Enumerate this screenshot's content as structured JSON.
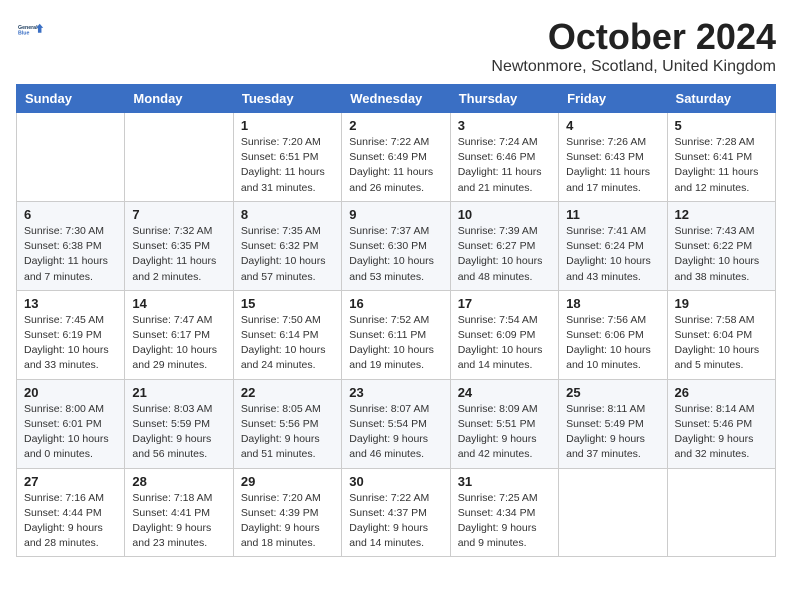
{
  "header": {
    "logo_line1": "General",
    "logo_line2": "Blue",
    "month_title": "October 2024",
    "location": "Newtonmore, Scotland, United Kingdom"
  },
  "days_of_week": [
    "Sunday",
    "Monday",
    "Tuesday",
    "Wednesday",
    "Thursday",
    "Friday",
    "Saturday"
  ],
  "weeks": [
    [
      {
        "num": "",
        "detail": ""
      },
      {
        "num": "",
        "detail": ""
      },
      {
        "num": "1",
        "detail": "Sunrise: 7:20 AM\nSunset: 6:51 PM\nDaylight: 11 hours and 31 minutes."
      },
      {
        "num": "2",
        "detail": "Sunrise: 7:22 AM\nSunset: 6:49 PM\nDaylight: 11 hours and 26 minutes."
      },
      {
        "num": "3",
        "detail": "Sunrise: 7:24 AM\nSunset: 6:46 PM\nDaylight: 11 hours and 21 minutes."
      },
      {
        "num": "4",
        "detail": "Sunrise: 7:26 AM\nSunset: 6:43 PM\nDaylight: 11 hours and 17 minutes."
      },
      {
        "num": "5",
        "detail": "Sunrise: 7:28 AM\nSunset: 6:41 PM\nDaylight: 11 hours and 12 minutes."
      }
    ],
    [
      {
        "num": "6",
        "detail": "Sunrise: 7:30 AM\nSunset: 6:38 PM\nDaylight: 11 hours and 7 minutes."
      },
      {
        "num": "7",
        "detail": "Sunrise: 7:32 AM\nSunset: 6:35 PM\nDaylight: 11 hours and 2 minutes."
      },
      {
        "num": "8",
        "detail": "Sunrise: 7:35 AM\nSunset: 6:32 PM\nDaylight: 10 hours and 57 minutes."
      },
      {
        "num": "9",
        "detail": "Sunrise: 7:37 AM\nSunset: 6:30 PM\nDaylight: 10 hours and 53 minutes."
      },
      {
        "num": "10",
        "detail": "Sunrise: 7:39 AM\nSunset: 6:27 PM\nDaylight: 10 hours and 48 minutes."
      },
      {
        "num": "11",
        "detail": "Sunrise: 7:41 AM\nSunset: 6:24 PM\nDaylight: 10 hours and 43 minutes."
      },
      {
        "num": "12",
        "detail": "Sunrise: 7:43 AM\nSunset: 6:22 PM\nDaylight: 10 hours and 38 minutes."
      }
    ],
    [
      {
        "num": "13",
        "detail": "Sunrise: 7:45 AM\nSunset: 6:19 PM\nDaylight: 10 hours and 33 minutes."
      },
      {
        "num": "14",
        "detail": "Sunrise: 7:47 AM\nSunset: 6:17 PM\nDaylight: 10 hours and 29 minutes."
      },
      {
        "num": "15",
        "detail": "Sunrise: 7:50 AM\nSunset: 6:14 PM\nDaylight: 10 hours and 24 minutes."
      },
      {
        "num": "16",
        "detail": "Sunrise: 7:52 AM\nSunset: 6:11 PM\nDaylight: 10 hours and 19 minutes."
      },
      {
        "num": "17",
        "detail": "Sunrise: 7:54 AM\nSunset: 6:09 PM\nDaylight: 10 hours and 14 minutes."
      },
      {
        "num": "18",
        "detail": "Sunrise: 7:56 AM\nSunset: 6:06 PM\nDaylight: 10 hours and 10 minutes."
      },
      {
        "num": "19",
        "detail": "Sunrise: 7:58 AM\nSunset: 6:04 PM\nDaylight: 10 hours and 5 minutes."
      }
    ],
    [
      {
        "num": "20",
        "detail": "Sunrise: 8:00 AM\nSunset: 6:01 PM\nDaylight: 10 hours and 0 minutes."
      },
      {
        "num": "21",
        "detail": "Sunrise: 8:03 AM\nSunset: 5:59 PM\nDaylight: 9 hours and 56 minutes."
      },
      {
        "num": "22",
        "detail": "Sunrise: 8:05 AM\nSunset: 5:56 PM\nDaylight: 9 hours and 51 minutes."
      },
      {
        "num": "23",
        "detail": "Sunrise: 8:07 AM\nSunset: 5:54 PM\nDaylight: 9 hours and 46 minutes."
      },
      {
        "num": "24",
        "detail": "Sunrise: 8:09 AM\nSunset: 5:51 PM\nDaylight: 9 hours and 42 minutes."
      },
      {
        "num": "25",
        "detail": "Sunrise: 8:11 AM\nSunset: 5:49 PM\nDaylight: 9 hours and 37 minutes."
      },
      {
        "num": "26",
        "detail": "Sunrise: 8:14 AM\nSunset: 5:46 PM\nDaylight: 9 hours and 32 minutes."
      }
    ],
    [
      {
        "num": "27",
        "detail": "Sunrise: 7:16 AM\nSunset: 4:44 PM\nDaylight: 9 hours and 28 minutes."
      },
      {
        "num": "28",
        "detail": "Sunrise: 7:18 AM\nSunset: 4:41 PM\nDaylight: 9 hours and 23 minutes."
      },
      {
        "num": "29",
        "detail": "Sunrise: 7:20 AM\nSunset: 4:39 PM\nDaylight: 9 hours and 18 minutes."
      },
      {
        "num": "30",
        "detail": "Sunrise: 7:22 AM\nSunset: 4:37 PM\nDaylight: 9 hours and 14 minutes."
      },
      {
        "num": "31",
        "detail": "Sunrise: 7:25 AM\nSunset: 4:34 PM\nDaylight: 9 hours and 9 minutes."
      },
      {
        "num": "",
        "detail": ""
      },
      {
        "num": "",
        "detail": ""
      }
    ]
  ]
}
